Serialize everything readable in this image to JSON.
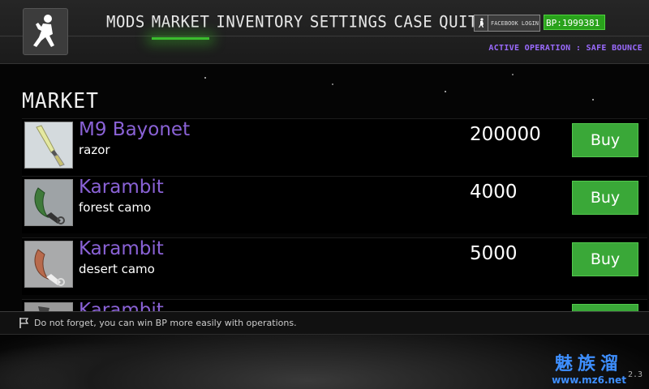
{
  "nav": {
    "items": [
      "MODS",
      "MARKET",
      "INVENTORY",
      "SETTINGS",
      "CASE",
      "QUIT"
    ],
    "active_index": 1
  },
  "account": {
    "facebook_login_label": "FACEBOOK LOGIN",
    "bp_balance": "BP:1999381"
  },
  "operation": {
    "text": "ACTIVE OPERATION : SAFE BOUNCE"
  },
  "market": {
    "title": "MARKET",
    "items": [
      {
        "name": "M9 Bayonet",
        "skin": "razor",
        "price": "200000",
        "buy_label": "Buy",
        "icon": "m9-bayonet-razor-icon"
      },
      {
        "name": "Karambit",
        "skin": "forest camo",
        "price": "4000",
        "buy_label": "Buy",
        "icon": "karambit-forest-camo-icon"
      },
      {
        "name": "Karambit",
        "skin": "desert camo",
        "price": "5000",
        "buy_label": "Buy",
        "icon": "karambit-desert-camo-icon"
      },
      {
        "name": "Karambit",
        "skin": "",
        "price": "",
        "buy_label": "",
        "icon": "karambit-icon"
      }
    ]
  },
  "footer": {
    "tip": "Do not forget, you can win BP more easily with operations."
  },
  "version": "2.3",
  "watermark": {
    "line1": "魅族溜",
    "line2": "www.mz6.net"
  },
  "colors": {
    "accent_green": "#3aa838",
    "item_name_purple": "#8a62d6",
    "operation_purple": "#9b6bff"
  }
}
